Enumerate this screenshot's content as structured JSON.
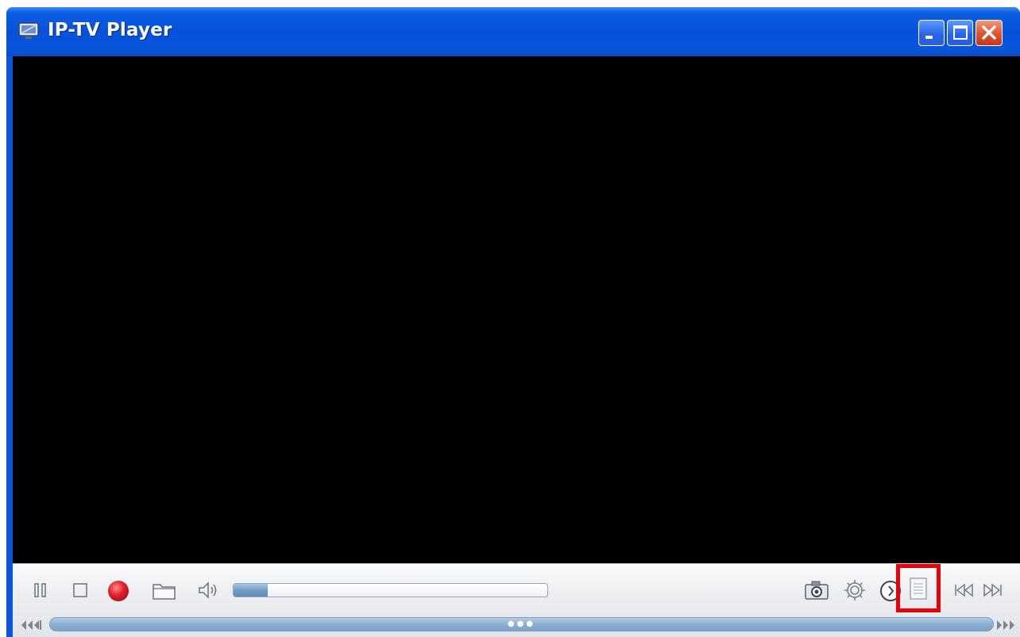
{
  "window": {
    "title": "IP-TV Player",
    "icons": {
      "app": "tv-monitor-icon",
      "minimize": "minimize-icon",
      "maximize": "maximize-icon",
      "close": "close-icon"
    }
  },
  "controls": {
    "left": [
      {
        "name": "pause-button",
        "icon": "pause-icon"
      },
      {
        "name": "stop-button",
        "icon": "stop-icon"
      },
      {
        "name": "record-button",
        "icon": "record-icon"
      },
      {
        "name": "open-file-button",
        "icon": "folder-icon"
      },
      {
        "name": "mute-button",
        "icon": "speaker-icon"
      }
    ],
    "volume_level": 0.11,
    "right": [
      {
        "name": "snapshot-button",
        "icon": "camera-icon"
      },
      {
        "name": "settings-button",
        "icon": "gear-icon"
      },
      {
        "name": "schedule-button",
        "icon": "clock-icon"
      },
      {
        "name": "playlist-button",
        "icon": "playlist-icon",
        "highlighted": true
      },
      {
        "name": "previous-channel-button",
        "icon": "skip-back-icon"
      },
      {
        "name": "next-channel-button",
        "icon": "skip-forward-icon"
      }
    ],
    "seek": {
      "rewind_icon": "rewind-icon",
      "forward_icon": "fast-forward-icon",
      "handle_icon": "drag-handle-icon"
    }
  },
  "colors": {
    "titlebar": "#0752dc",
    "highlight": "#e8000b",
    "record": "#e4232c"
  }
}
